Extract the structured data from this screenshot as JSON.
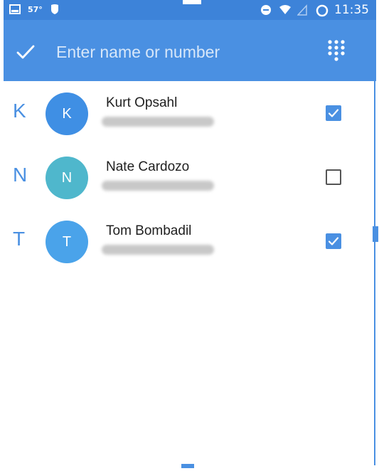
{
  "status_bar": {
    "temperature": "57°",
    "time": "11:35"
  },
  "toolbar": {
    "search_placeholder": "Enter name or number",
    "confirm_icon": "check-icon",
    "dialpad_icon": "dialpad-icon"
  },
  "contacts": [
    {
      "letter": "K",
      "initial": "K",
      "name": "Kurt Opsahl",
      "selected": true,
      "avatar_color": "#3f8fe4"
    },
    {
      "letter": "N",
      "initial": "N",
      "name": "Nate Cardozo",
      "selected": false,
      "avatar_color": "#4fb7cc"
    },
    {
      "letter": "T",
      "initial": "T",
      "name": "Tom Bombadil",
      "selected": true,
      "avatar_color": "#4aa3ea"
    }
  ],
  "colors": {
    "accent": "#4a90e2",
    "status_bar": "#3d83d9"
  }
}
